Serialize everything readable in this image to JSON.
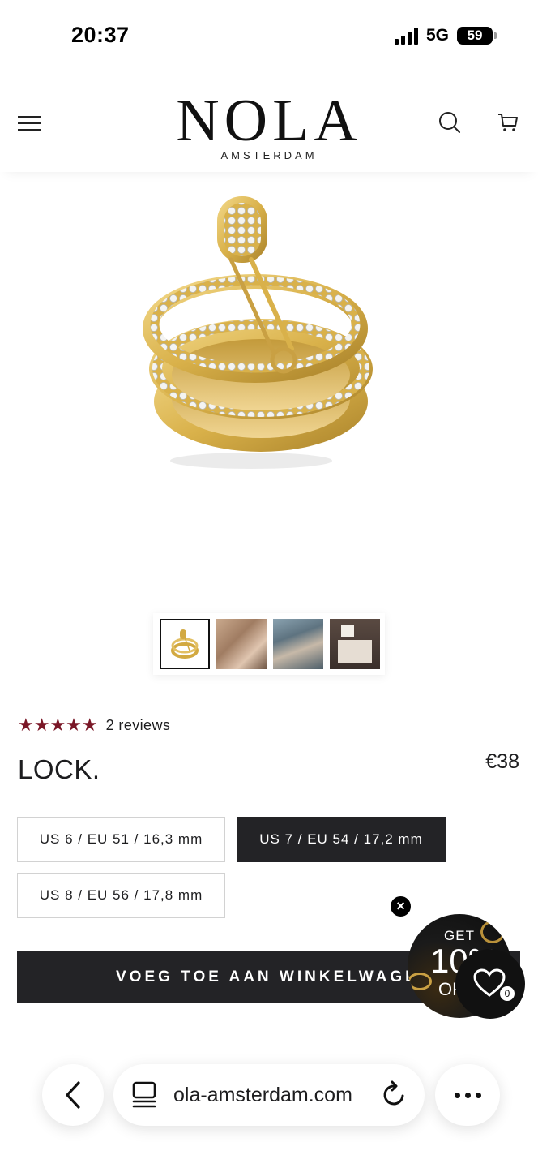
{
  "status_bar": {
    "time": "20:37",
    "network": "5G",
    "battery": "59"
  },
  "header": {
    "brand": "NOLA",
    "brand_sub": "AMSTERDAM",
    "menu_icon": "hamburger-menu-icon",
    "search_icon": "search-icon",
    "cart_icon": "cart-icon"
  },
  "gallery": {
    "thumbnails": [
      "ring-product",
      "model-face-ring",
      "hand-with-ring",
      "packaging-box"
    ],
    "active_index": 0
  },
  "product": {
    "rating": 5,
    "reviews_text": "2 reviews",
    "title": "LOCK.",
    "price": "€38",
    "sizes": [
      {
        "label": "US 6 / EU 51 / 16,3 mm",
        "selected": false
      },
      {
        "label": "US 7 / EU 54 / 17,2 mm",
        "selected": true
      },
      {
        "label": "US 8 / EU 56 / 17,8 mm",
        "selected": false
      }
    ],
    "add_to_cart": "VOEG TOE AAN WINKELWAGEN"
  },
  "promo": {
    "get": "GET",
    "big": "10%",
    "off": "OFF",
    "close": "×"
  },
  "wishlist": {
    "count": "0"
  },
  "browser": {
    "url": "ola-amsterdam.com"
  },
  "colors": {
    "accent": "#232326",
    "star": "#7a1727",
    "gold": "#d9b14a"
  }
}
